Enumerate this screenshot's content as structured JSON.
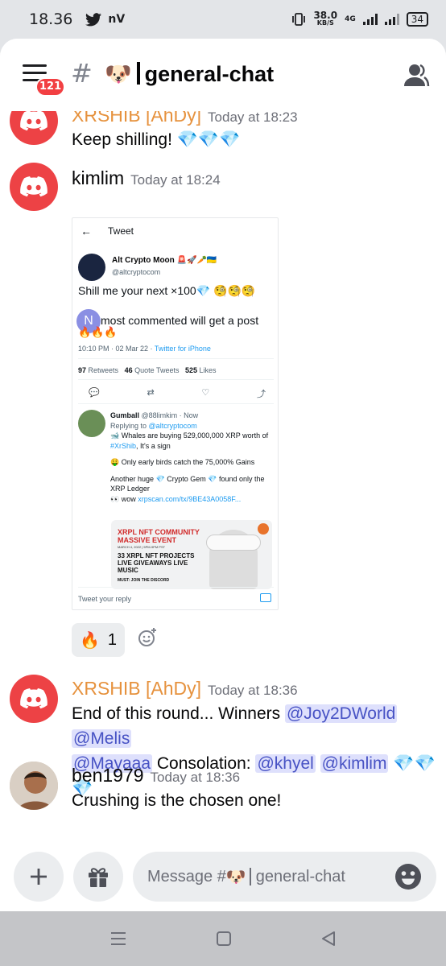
{
  "status_bar": {
    "time": "18.36",
    "carrier_label": "nV",
    "net_speed_value": "38.0",
    "net_speed_unit": "KB/S",
    "network_type": "4G",
    "battery": "34"
  },
  "header": {
    "unread_badge": "121",
    "channel_hash": "#",
    "channel_emoji": "🐶",
    "channel_name": "general-chat"
  },
  "messages": [
    {
      "author": "XRSHIB [AhDy]",
      "timestamp": "Today at 18:23",
      "text": "Keep shilling!",
      "trailing": "💎💎💎"
    },
    {
      "author": "kimlim",
      "timestamp": "Today at 18:24"
    },
    {
      "author": "XRSHIB [AhDy]",
      "timestamp": "Today at 18:36",
      "text_prefix": "End of this round... Winners",
      "mentions_1": [
        "@Joy2DWorld",
        "@Melis"
      ],
      "mention_2": "@Mayaaa",
      "text_mid": "Consolation:",
      "mentions_3": [
        "@khyel",
        "@kimlim"
      ],
      "trailing": "💎💎💎"
    },
    {
      "author": "ben1979",
      "timestamp": "Today at 18:36",
      "text": "Crushing is the chosen one!"
    }
  ],
  "tweet": {
    "header": "Tweet",
    "author_name": "Alt Crypto Moon 🚨🚀🥕🇺🇦",
    "author_handle": "@altcryptocom",
    "body_line1": "Shill me your next ×100💎 🧐🧐🧐",
    "body_line2": "most commented will get a post",
    "avatar_letter": "N",
    "fire_row": "🔥🔥🔥",
    "time": "10:10 PM · 02 Mar 22 ·",
    "via": "Twitter for iPhone",
    "retweets": "97",
    "retweets_label": "Retweets",
    "quotes": "46",
    "quotes_label": "Quote Tweets",
    "likes": "525",
    "likes_label": "Likes",
    "reply": {
      "name": "Gumball",
      "handle": "@88limkim · Now",
      "replying_to_label": "Replying to",
      "replying_to": "@altcryptocom",
      "line1": "🐋 Whales are buying 529,000,000 XRP worth of",
      "hashtag": "#XrShib",
      "line1_end": ", It's a sign",
      "line2": "🤑 Only early birds catch the 75,000% Gains",
      "line3": "Another huge 💎 Crypto Gem 💎 found only the XRP Ledger",
      "line4_prefix": "👀 wow",
      "line4_link": "xrpscan.com/tx/9BE43A0058F..."
    },
    "promo_title": "XRPL NFT COMMUNITY MASSIVE EVENT",
    "promo_date": "MARCH 4, 2022 | 5PM-9PM PST",
    "promo_lines": "33 XRPL NFT PROJECTS LIVE GIVEAWAYS LIVE MUSIC",
    "promo_must": "MUST: JOIN THE DISCORD",
    "reply_placeholder": "Tweet your reply"
  },
  "reaction": {
    "emoji": "🔥",
    "count": "1"
  },
  "composer": {
    "placeholder_prefix": "Message #",
    "placeholder_emoji": "🐶",
    "placeholder_channel": "general-chat"
  },
  "colors": {
    "discord_red": "#ed4245",
    "username_orange": "#e6923e",
    "mention_bg": "#dee0fc",
    "mention_text": "#4752c4",
    "twitter_blue": "#1d9bf0"
  }
}
